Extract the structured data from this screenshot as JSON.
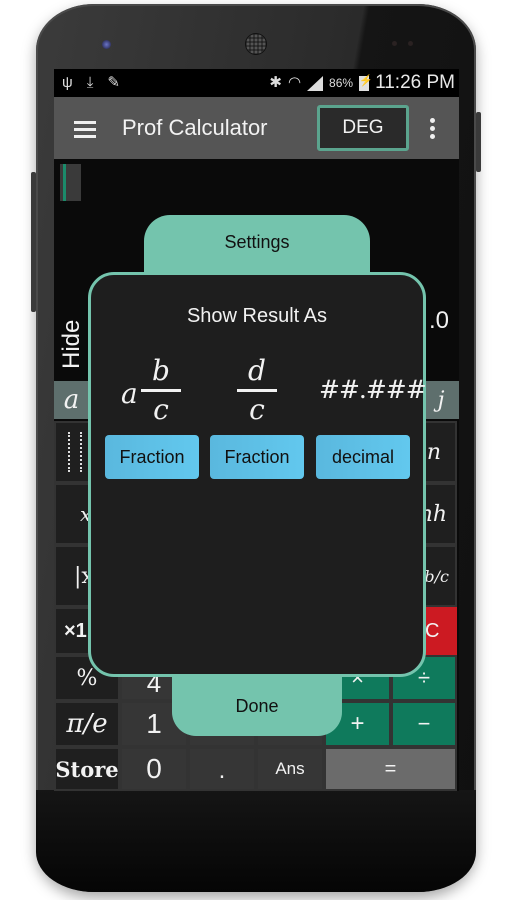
{
  "status_bar": {
    "left_icons": [
      "usb-icon",
      "download-icon",
      "edit-icon"
    ],
    "right_icons": [
      "bluetooth-icon",
      "wifi-icon",
      "signal-icon",
      "battery-charging-icon"
    ],
    "battery_percent": "86%",
    "time": "11:26 PM"
  },
  "app_bar": {
    "title": "Prof Calculator",
    "angle_mode": "DEG"
  },
  "display": {
    "hide_label": "Hide",
    "result_visible_fragment": ".0"
  },
  "variables": {
    "first": "a",
    "last": "j"
  },
  "keypad": {
    "left_column": [
      "",
      "x",
      "|x",
      "×1",
      "%",
      "π/e",
      "Store"
    ],
    "right_column_partial": [
      "n",
      "nh",
      "⇆b/c"
    ],
    "clear": "C",
    "numbers": {
      "four": "4",
      "one": "1",
      "zero": "0",
      "dot": "."
    },
    "ans": "Ans",
    "operators": {
      "multiply": "×",
      "divide": "÷",
      "plus": "+",
      "minus": "−"
    },
    "equals": "="
  },
  "dialog": {
    "tab_label": "Settings",
    "title": "Show Result As",
    "options": [
      {
        "preview": {
          "whole": "a",
          "numerator": "b",
          "denominator": "c"
        },
        "label": "Fraction"
      },
      {
        "preview": {
          "numerator": "d",
          "denominator": "c"
        },
        "label": "Fraction"
      },
      {
        "preview": {
          "text": "##.###"
        },
        "label": "decimal"
      }
    ],
    "done_label": "Done"
  },
  "colors": {
    "accent_teal": "#74c4ad",
    "deg_border": "#5ba48e",
    "option_button": "#5ec0e6",
    "operator_green": "#0f7a5c",
    "clear_red": "#cc1a22",
    "app_bar": "#555555"
  }
}
